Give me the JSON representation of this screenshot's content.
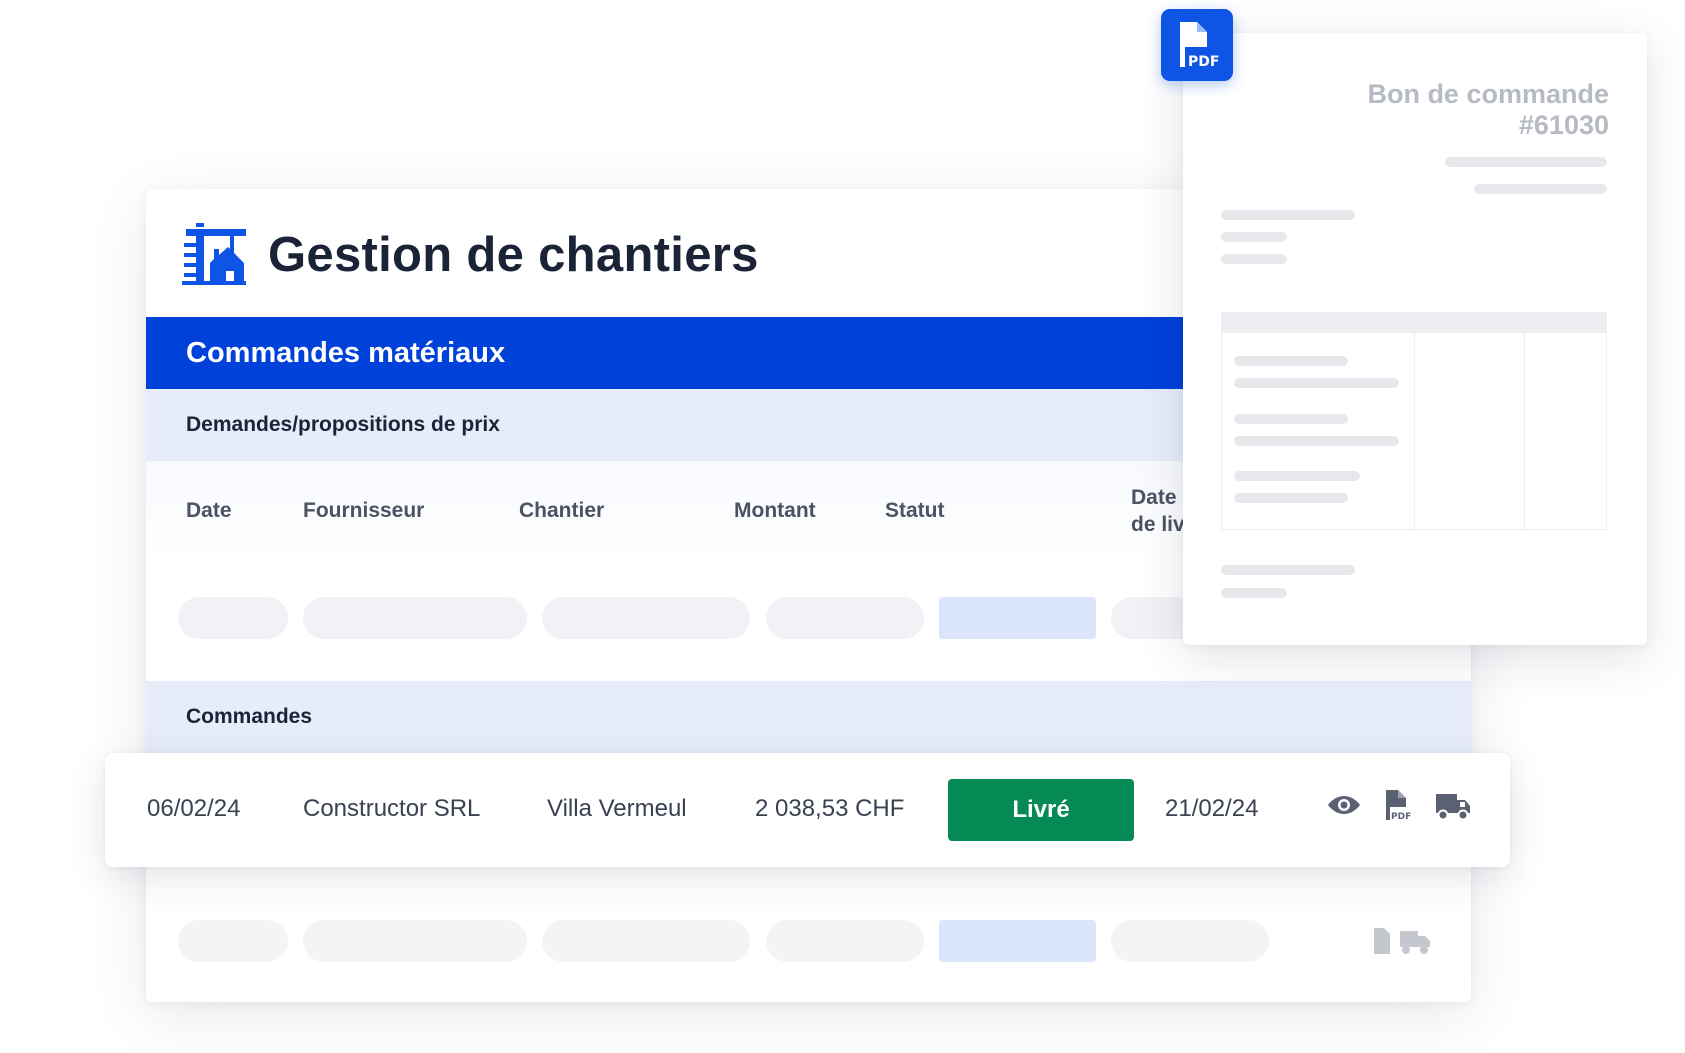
{
  "app": {
    "title": "Gestion de chantiers",
    "logo_icon": "construction-crane-icon",
    "accent_color": "#0041d9"
  },
  "section": {
    "title": "Commandes matériaux"
  },
  "quotes": {
    "title": "Demandes/propositions de prix"
  },
  "table": {
    "columns": [
      "Date",
      "Fournisseur",
      "Chantier",
      "Montant",
      "Statut",
      "Date",
      "de liv"
    ]
  },
  "orders": {
    "title": "Commandes",
    "row": {
      "date": "06/02/24",
      "supplier": "Constructor SRL",
      "site": "Villa Vermeul",
      "amount": "2 038,53 CHF",
      "status": "Livré",
      "status_color": "#058a55",
      "delivery_date": "21/02/24",
      "actions": [
        "eye-icon",
        "pdf-file-icon",
        "delivery-truck-icon"
      ]
    }
  },
  "document": {
    "title_line1": "Bon de commande",
    "title_line2": "#61030",
    "badge_label": "PDF"
  }
}
